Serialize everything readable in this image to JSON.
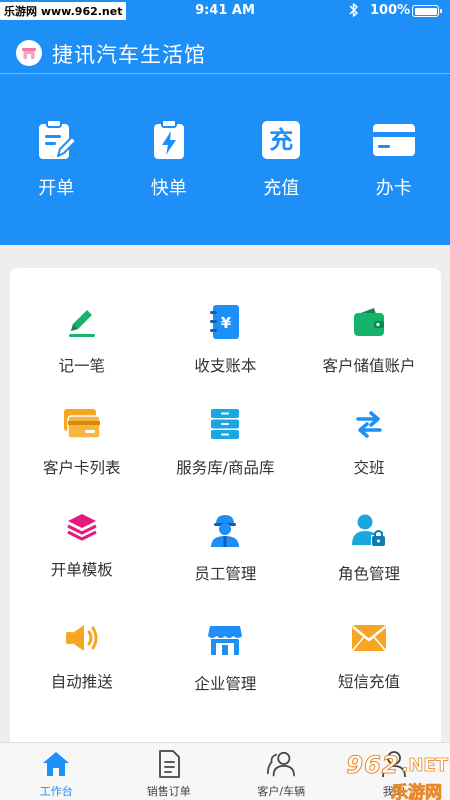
{
  "status_bar": {
    "carrier": "乐游网 www.962.net",
    "time": "9:41 AM",
    "battery": "100%"
  },
  "header": {
    "title": "捷讯汽车生活馆"
  },
  "quick_actions": [
    {
      "label": "开单",
      "icon": "clipboard-edit-icon"
    },
    {
      "label": "快单",
      "icon": "clipboard-bolt-icon"
    },
    {
      "label": "充值",
      "icon": "recharge-icon",
      "glyph": "充"
    },
    {
      "label": "办卡",
      "icon": "card-icon"
    }
  ],
  "features": [
    {
      "label": "记一笔",
      "icon": "pen-icon"
    },
    {
      "label": "收支账本",
      "icon": "ledger-icon"
    },
    {
      "label": "客户储值账户",
      "icon": "wallet-icon"
    },
    {
      "label": "客户卡列表",
      "icon": "cards-icon"
    },
    {
      "label": "服务库/商品库",
      "icon": "cabinet-icon"
    },
    {
      "label": "交班",
      "icon": "swap-icon"
    },
    {
      "label": "开单模板",
      "icon": "layers-icon"
    },
    {
      "label": "员工管理",
      "icon": "worker-icon"
    },
    {
      "label": "角色管理",
      "icon": "user-lock-icon"
    },
    {
      "label": "自动推送",
      "icon": "speaker-icon"
    },
    {
      "label": "企业管理",
      "icon": "store-icon"
    },
    {
      "label": "短信充值",
      "icon": "envelope-icon"
    }
  ],
  "tabs": [
    {
      "label": "工作台",
      "icon": "home-icon",
      "active": true
    },
    {
      "label": "销售订单",
      "icon": "document-icon",
      "active": false
    },
    {
      "label": "客户/车辆",
      "icon": "customers-icon",
      "active": false
    },
    {
      "label": "我的",
      "icon": "profile-icon",
      "active": false
    }
  ],
  "watermark": {
    "top": "962",
    "bottom": "乐游网"
  },
  "colors": {
    "brand_blue": "#1e8ff7",
    "green": "#16b36b",
    "orange": "#f6a623",
    "magenta": "#e6197c",
    "cyan": "#1aa7e0"
  }
}
